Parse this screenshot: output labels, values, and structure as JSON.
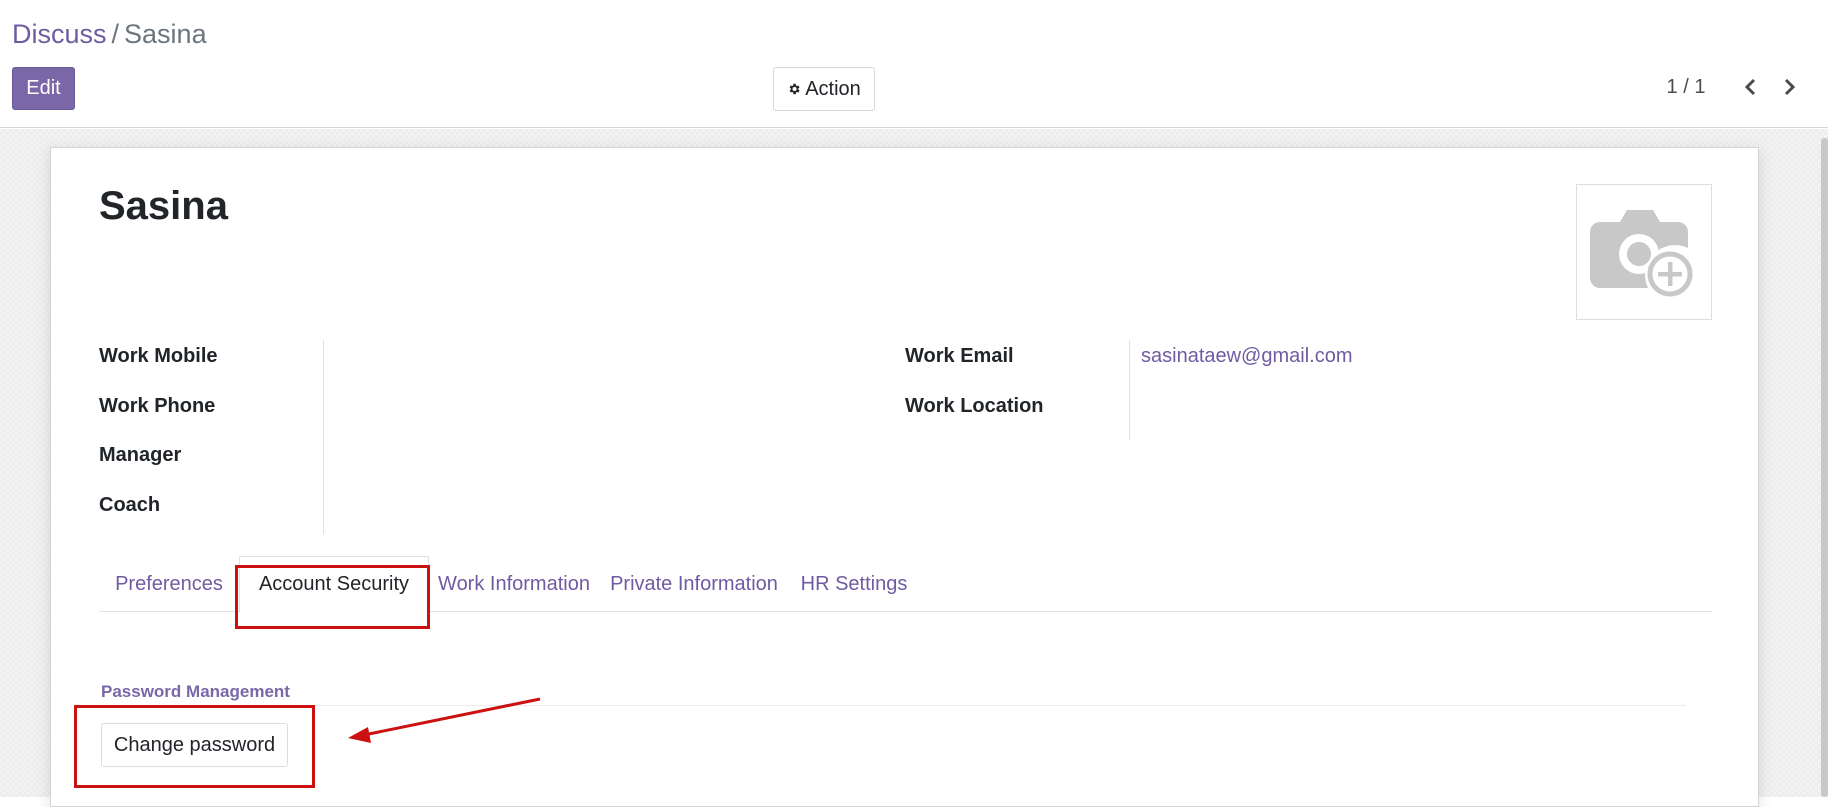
{
  "breadcrumb": {
    "parent": "Discuss",
    "separator": "/",
    "current": "Sasina"
  },
  "toolbar": {
    "edit_label": "Edit",
    "action_label": "Action",
    "action_icon": "gear-icon"
  },
  "pager": {
    "value": "1 / 1",
    "prev_icon": "chevron-left-icon",
    "next_icon": "chevron-right-icon"
  },
  "employee": {
    "name": "Sasina",
    "avatar_icon": "camera-plus-icon"
  },
  "fields_left": [
    {
      "label": "Work Mobile",
      "value": ""
    },
    {
      "label": "Work Phone",
      "value": ""
    },
    {
      "label": "Manager",
      "value": ""
    },
    {
      "label": "Coach",
      "value": ""
    }
  ],
  "fields_right": [
    {
      "label": "Work Email",
      "value": "sasinataew@gmail.com"
    },
    {
      "label": "Work Location",
      "value": ""
    }
  ],
  "tabs": [
    {
      "label": "Preferences",
      "active": false
    },
    {
      "label": "Account Security",
      "active": true
    },
    {
      "label": "Work Information",
      "active": false
    },
    {
      "label": "Private Information",
      "active": false
    },
    {
      "label": "HR Settings",
      "active": false
    }
  ],
  "account_security": {
    "section_title": "Password Management",
    "change_password_label": "Change password"
  },
  "colors": {
    "brand": "#7a67a8",
    "link": "#6f5ba2",
    "annotation": "#cc1111"
  }
}
